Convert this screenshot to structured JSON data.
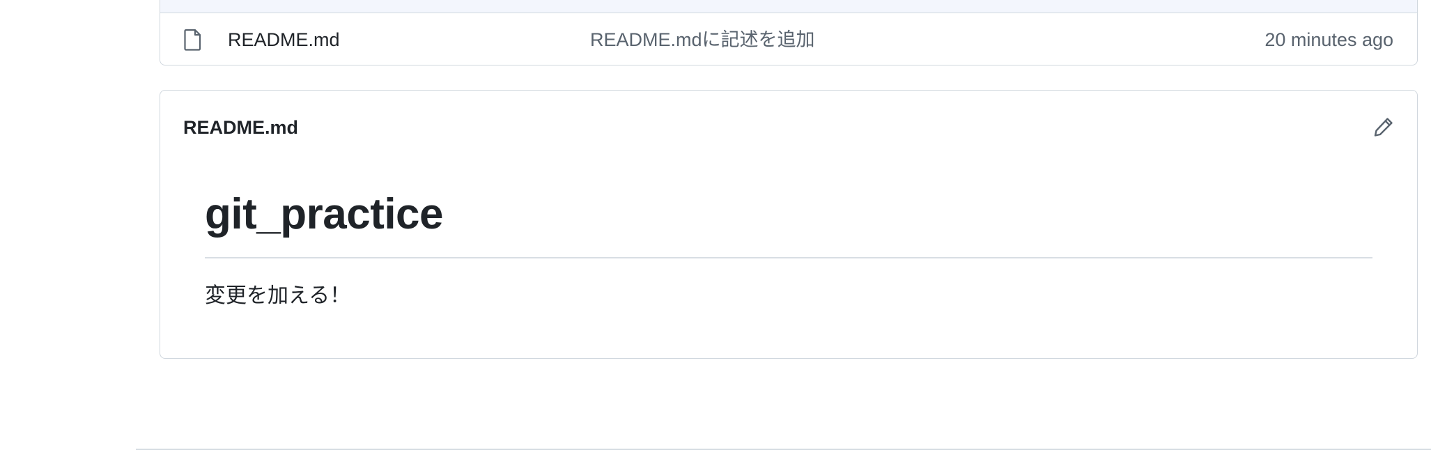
{
  "file_list": {
    "rows": [
      {
        "icon": "file-icon",
        "name": "README.md",
        "commit_message": "README.mdに記述を追加",
        "age": "20 minutes ago"
      }
    ]
  },
  "readme": {
    "title": "README.md",
    "edit_icon": "pencil-icon",
    "heading": "git_practice",
    "body": "変更を加える！"
  },
  "colors": {
    "border": "#d0d7de",
    "header_strip": "#f3f6fd",
    "text_primary": "#1f2328",
    "text_muted": "#59636e"
  }
}
